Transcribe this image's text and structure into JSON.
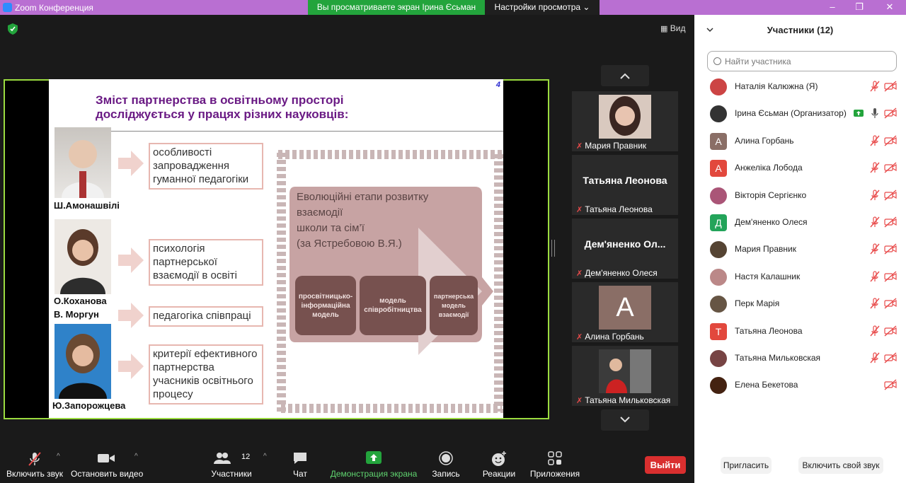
{
  "titlebar": {
    "title": "Zoom Конференция",
    "viewing": "Вы просматриваете экран Ірина Єсьман",
    "view_options": "Настройки просмотра ⌄"
  },
  "top": {
    "view_label": "Вид"
  },
  "slide": {
    "page_number": "4",
    "heading_line1": "Зміст партнерства в освітньому просторі",
    "heading_line2": "досліджується у працях різних науковців:",
    "people": [
      {
        "name": "Ш.Амонашвілі"
      },
      {
        "name": "О.Коханова"
      },
      {
        "name": "В. Моргун"
      },
      {
        "name": "Ю.Запорожцева"
      }
    ],
    "topics": [
      "особливості запровадження гуманної педагогіки",
      "психологія партнерської взаємодії в освіті",
      "педагогіка співпраці",
      "критерії ефективного партнерства учасників освітнього процесу"
    ],
    "frame_title_1": "Еволюційні етапи розвитку взаємодії",
    "frame_title_2": "школи та сім’ї",
    "frame_title_3": "(за Ястребовою В.Я.)",
    "stages": [
      "просвітницько-інформаційна модель",
      "модель співробітництва",
      "партнерська модель взаємодії"
    ]
  },
  "tiles": [
    {
      "name": "Мария Правник"
    },
    {
      "name": "Татьяна Леонова",
      "big": "Татьяна Леонова"
    },
    {
      "name": "Дем'яненко Олеся",
      "big": "Дем'яненко  Ол..."
    },
    {
      "name": "Алина Горбань",
      "letter": "A"
    },
    {
      "name": "Татьяна Мильковская"
    }
  ],
  "participants": {
    "title": "Участники (12)",
    "search_placeholder": "Найти участника",
    "list": [
      {
        "name": "Наталія Калюжна (Я)",
        "color": "#c44"
      },
      {
        "name": "Ірина Єсьман (Организатор)",
        "color": "#333"
      },
      {
        "name": "Алина Горбань",
        "letter": "А",
        "color": "#8a6e66"
      },
      {
        "name": "Анжеліка Лобода",
        "letter": "А",
        "color": "#e2483d"
      },
      {
        "name": "Вікторія Сергієнко",
        "color": "#a57"
      },
      {
        "name": "Дем'яненко Олеся",
        "letter": "Д",
        "color": "#23a45a"
      },
      {
        "name": "Мария Правник",
        "color": "#543"
      },
      {
        "name": "Настя Калашник",
        "color": "#b88"
      },
      {
        "name": "Перк Марія",
        "color": "#654"
      },
      {
        "name": "Татьяна Леонова",
        "letter": "Т",
        "color": "#e2483d"
      },
      {
        "name": "Татьяна Мильковская",
        "color": "#744"
      },
      {
        "name": "Елена Бекетова",
        "color": "#421"
      }
    ],
    "invite": "Пригласить",
    "unmute_self": "Включить свой звук"
  },
  "toolbar": {
    "unmute": "Включить звук",
    "stop_video": "Остановить видео",
    "participants": "Участники",
    "participants_count": "12",
    "chat": "Чат",
    "share": "Демонстрация экрана",
    "record": "Запись",
    "reactions": "Реакции",
    "apps": "Приложения",
    "leave": "Выйти"
  },
  "colors": {
    "share_green": "#23a43c",
    "titlebar": "#b96fd2",
    "leave_red": "#d92f2f",
    "slide_purple": "#6a1a84"
  }
}
